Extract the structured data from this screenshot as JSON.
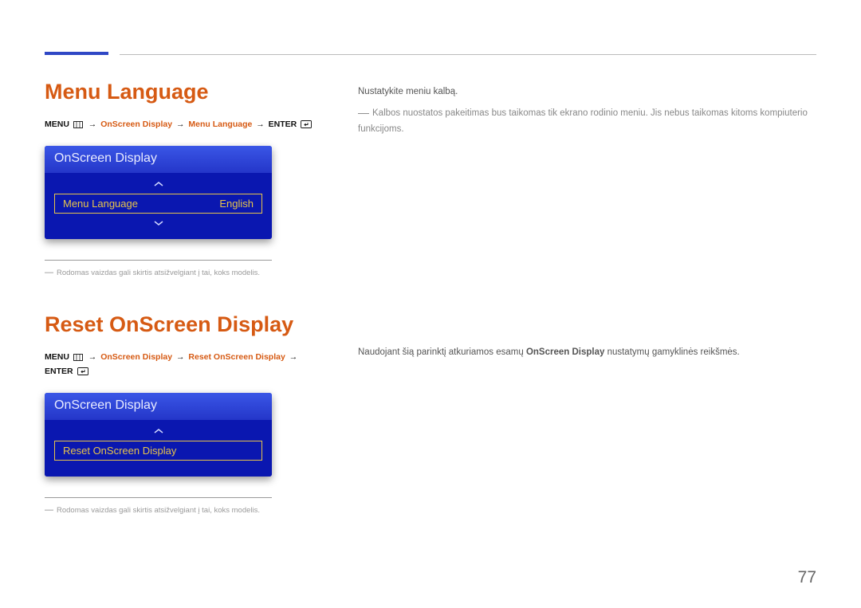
{
  "pageNumber": "77",
  "section1": {
    "title": "Menu Language",
    "breadcrumb": {
      "menu": "MENU",
      "p1": "OnScreen Display",
      "p2": "Menu Language",
      "enter": "ENTER"
    },
    "osd": {
      "header": "OnScreen Display",
      "rowLabel": "Menu Language",
      "rowValue": "English"
    },
    "footnote": "Rodomas vaizdas gali skirtis atsižvelgiant į tai, koks modelis.",
    "right": {
      "line1": "Nustatykite meniu kalbą.",
      "note": "Kalbos nuostatos pakeitimas bus taikomas tik ekrano rodinio meniu. Jis nebus taikomas kitoms kompiuterio funkcijoms."
    }
  },
  "section2": {
    "title": "Reset OnScreen Display",
    "breadcrumb": {
      "menu": "MENU",
      "p1": "OnScreen Display",
      "p2": "Reset OnScreen Display",
      "enter": "ENTER"
    },
    "osd": {
      "header": "OnScreen Display",
      "rowLabel": "Reset OnScreen Display"
    },
    "footnote": "Rodomas vaizdas gali skirtis atsižvelgiant į tai, koks modelis.",
    "right": {
      "pre": "Naudojant šią parinktį atkuriamos esamų ",
      "bold": "OnScreen Display",
      "post": " nustatymų gamyklinės reikšmės."
    }
  }
}
